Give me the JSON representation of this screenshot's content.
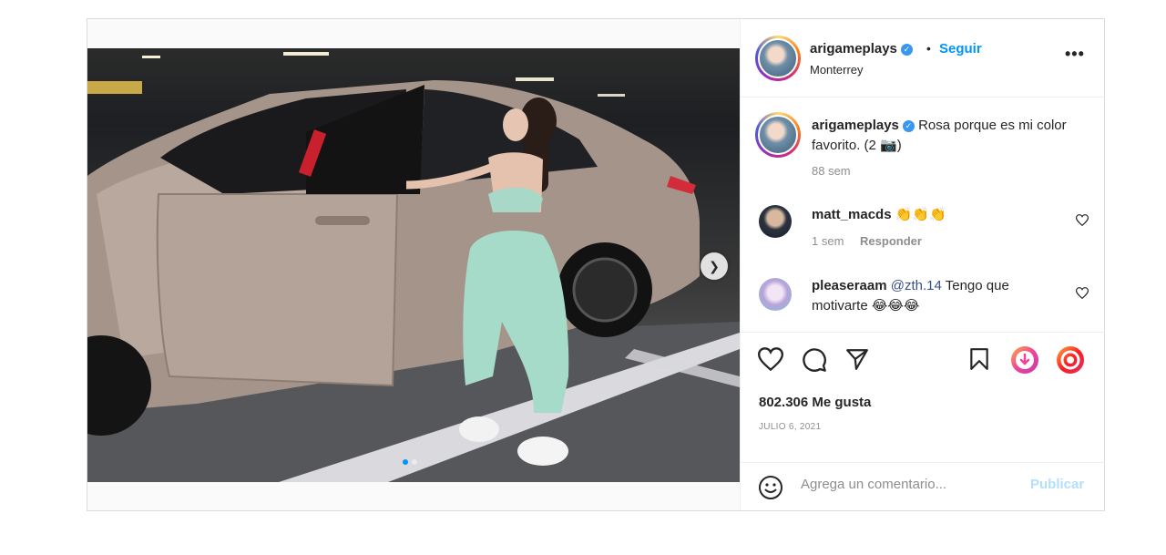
{
  "header": {
    "username": "arigameplays",
    "separator": "•",
    "follow_label": "Seguir",
    "location": "Monterrey",
    "more": "•••"
  },
  "caption": {
    "username": "arigameplays",
    "text": "Rosa porque es mi color favorito. (2 📷)",
    "time": "88 sem"
  },
  "comments": [
    {
      "username": "matt_macds",
      "text": "👏👏👏",
      "time": "1 sem",
      "reply_label": "Responder"
    },
    {
      "username": "pleaseraam",
      "mention": "@zth.14",
      "text": "Tengo que motivarte 😂😂😂"
    }
  ],
  "carousel": {
    "next_icon": "chevron-right-icon",
    "page_count": 2,
    "active_index": 0
  },
  "actions": {
    "likes": "802.306 Me gusta",
    "date": "JULIO 6, 2021"
  },
  "composer": {
    "placeholder": "Agrega un comentario...",
    "publish_label": "Publicar"
  },
  "colors": {
    "accent": "#0095f6",
    "publish_disabled": "#b2dffc",
    "muted": "#8e8e8e"
  }
}
